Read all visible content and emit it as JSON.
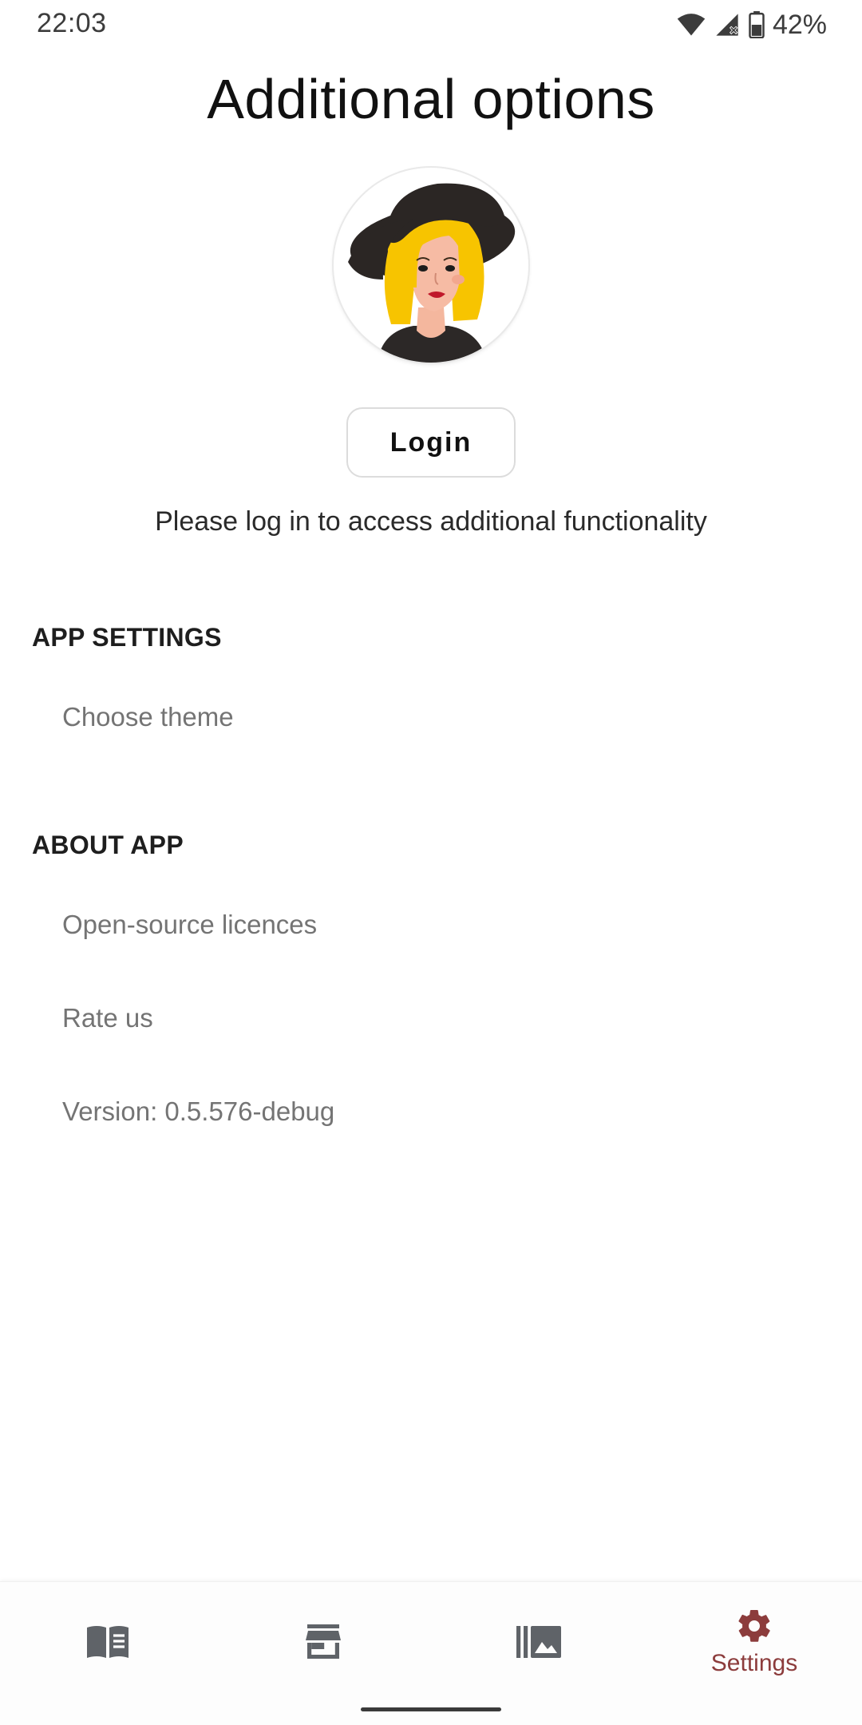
{
  "status_bar": {
    "time": "22:03",
    "battery": "42%",
    "icons": [
      "wifi-icon",
      "signal-icon",
      "battery-icon"
    ]
  },
  "header": {
    "title": "Additional options"
  },
  "profile": {
    "avatar": "avatar-woman-hat",
    "login_label": "Login",
    "hint": "Please log in to access additional functionality"
  },
  "sections": {
    "app_settings": {
      "title": "APP SETTINGS",
      "items": [
        "Choose theme"
      ]
    },
    "about_app": {
      "title": "ABOUT APP",
      "items": [
        "Open-source licences",
        "Rate us",
        "Version: 0.5.576-debug"
      ]
    }
  },
  "bottom_nav": {
    "items": [
      {
        "icon": "book-icon",
        "label": ""
      },
      {
        "icon": "store-icon",
        "label": ""
      },
      {
        "icon": "gallery-icon",
        "label": ""
      },
      {
        "icon": "gear-icon",
        "label": "Settings"
      }
    ],
    "active_index": 3
  },
  "colors": {
    "accent": "#8c3c3c",
    "icon_inactive": "#5f6368"
  }
}
